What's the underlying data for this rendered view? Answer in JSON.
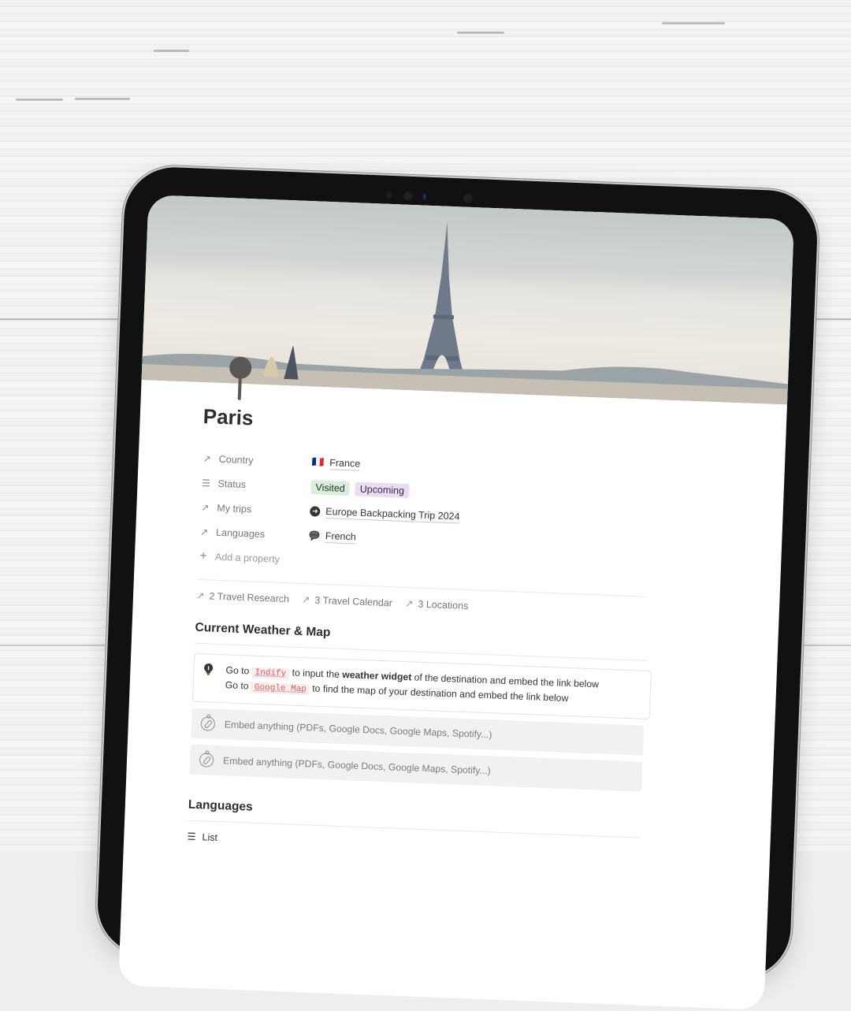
{
  "page": {
    "title": "Paris",
    "icon": "map-pin-icon"
  },
  "properties": [
    {
      "name": "Country",
      "icon": "relation-arrow-icon",
      "icon_glyph": "↗",
      "value": "France",
      "value_icon": "🇫🇷"
    },
    {
      "name": "Status",
      "icon": "list-icon",
      "icon_glyph": "☰",
      "tags": [
        {
          "label": "Visited",
          "color": "#dbeddb"
        },
        {
          "label": "Upcoming",
          "color": "#e8deee"
        }
      ]
    },
    {
      "name": "My trips",
      "icon": "relation-arrow-icon",
      "icon_glyph": "↗",
      "value": "Europe Backpacking Trip 2024",
      "value_icon": "➜"
    },
    {
      "name": "Languages",
      "icon": "relation-arrow-icon",
      "icon_glyph": "↗",
      "value": "French",
      "value_icon": "💬"
    }
  ],
  "add_property": {
    "label": "Add a property",
    "icon_glyph": "+"
  },
  "relations": [
    {
      "label": "2 Travel Research",
      "icon_glyph": "↗"
    },
    {
      "label": "3 Travel Calendar",
      "icon_glyph": "↗"
    },
    {
      "label": "3 Locations",
      "icon_glyph": "↗"
    }
  ],
  "section_weather": {
    "heading": "Current Weather & Map",
    "callout": {
      "icon_glyph": "💡",
      "line1": {
        "pre": "Go to ",
        "code": "Indify",
        "mid": " to input the ",
        "bold": "weather widget",
        "post": " of the destination and embed the link below"
      },
      "line2": {
        "pre": "Go to ",
        "code": "Google Map",
        "post": " to find the map of your destination and embed the link below"
      }
    },
    "embeds": [
      {
        "label": "Embed anything (PDFs, Google Docs, Google Maps, Spotify...)"
      },
      {
        "label": "Embed anything (PDFs, Google Docs, Google Maps, Spotify...)"
      }
    ]
  },
  "section_languages": {
    "heading": "Languages",
    "view": {
      "label": "List",
      "icon_glyph": "☰"
    }
  },
  "colors": {
    "tag_green": "#dbeddb",
    "tag_purple": "#e8deee",
    "code_red": "#eb5757",
    "embed_bg": "#f1f1ef"
  }
}
